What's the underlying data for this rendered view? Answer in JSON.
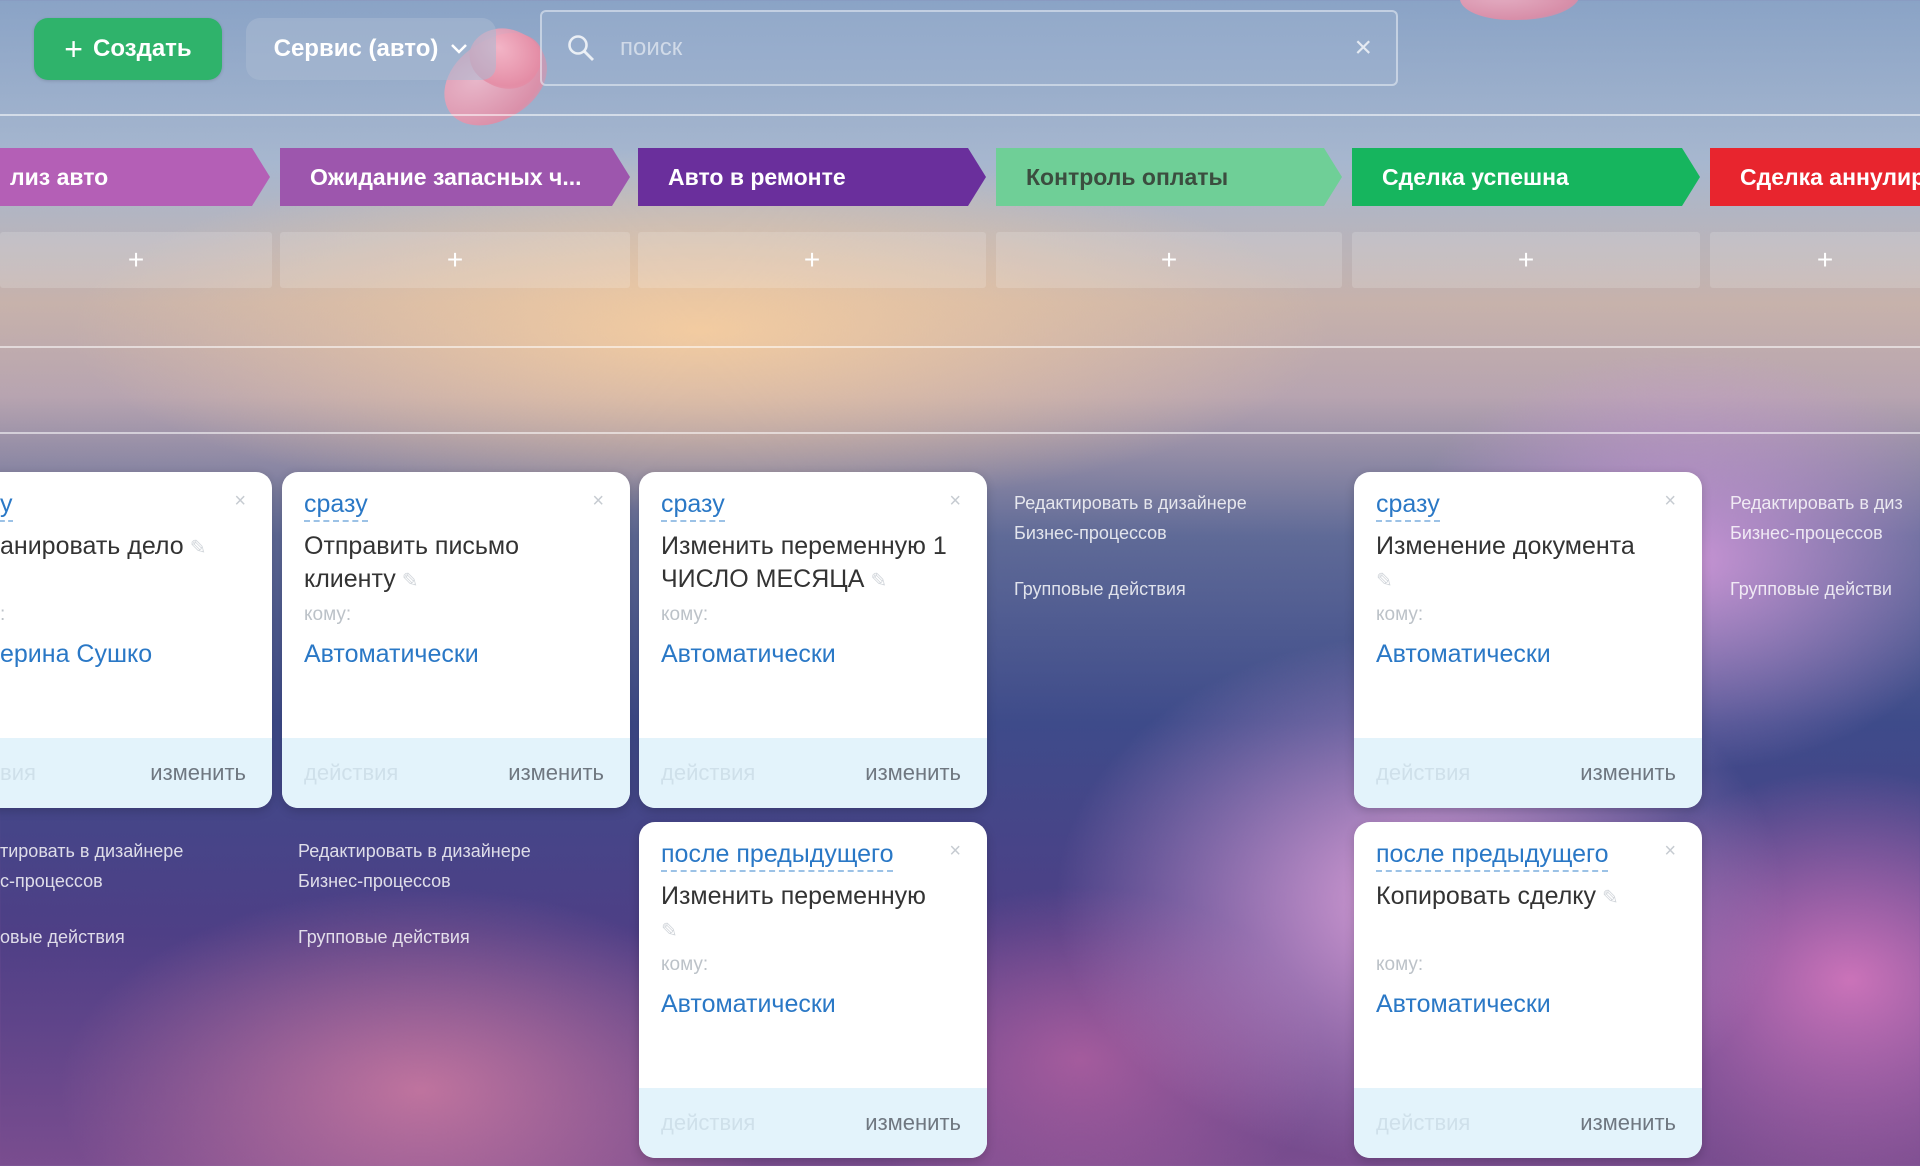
{
  "toolbar": {
    "create_label": "Создать",
    "service_label": "Сервис (авто)",
    "search_placeholder": "поиск"
  },
  "stages": [
    {
      "label": "лиз авто",
      "color": "#b45fb6"
    },
    {
      "label": "Ожидание запасных ч...",
      "color": "#9d56ad"
    },
    {
      "label": "Авто в ремонте",
      "color": "#6a2f9c"
    },
    {
      "label": "Контроль оплаты",
      "color": "#6fcf97"
    },
    {
      "label": "Сделка успешна",
      "color": "#16b55e"
    },
    {
      "label": "Сделка аннулир",
      "color": "#e8252e"
    }
  ],
  "add_symbol": "+",
  "links": {
    "edit_designer_line1": "Редактировать в дизайнере",
    "edit_designer_line2": "Бизнес-процессов",
    "group_actions": "Групповые действия",
    "partial_col1_line1": "тировать в дизайнере",
    "partial_col1_line2": "с-процессов",
    "partial_col1_group": "овые действия",
    "partial_col6_line1": "Редактировать в диз",
    "partial_col6_line2": "Бизнес-процессов",
    "partial_col6_group": "Групповые действи"
  },
  "cards": [
    {
      "when": "у",
      "title": "анировать дело",
      "to_label": ":",
      "to_value": "ерина Сушко",
      "actions": "вия",
      "edit": "изменить"
    },
    {
      "when": "сразу",
      "title": "Отправить письмо клиенту",
      "to_label": "кому:",
      "to_value": "Автоматически",
      "actions": "действия",
      "edit": "изменить"
    },
    {
      "when": "сразу",
      "title": "Изменить переменную 1 ЧИСЛО МЕСЯЦА",
      "to_label": "кому:",
      "to_value": "Автоматически",
      "actions": "действия",
      "edit": "изменить"
    },
    {
      "when": "после предыдущего",
      "title": "Изменить переменную",
      "to_label": "кому:",
      "to_value": "Автоматически",
      "actions": "действия",
      "edit": "изменить"
    },
    {
      "when": "сразу",
      "title": "Изменение документа",
      "to_label": "кому:",
      "to_value": "Автоматически",
      "actions": "действия",
      "edit": "изменить"
    },
    {
      "when": "после предыдущего",
      "title": "Копировать сделку",
      "to_label": "кому:",
      "to_value": "Автоматически",
      "actions": "действия",
      "edit": "изменить"
    }
  ],
  "icons": {
    "close": "×",
    "pencil": "✎"
  }
}
